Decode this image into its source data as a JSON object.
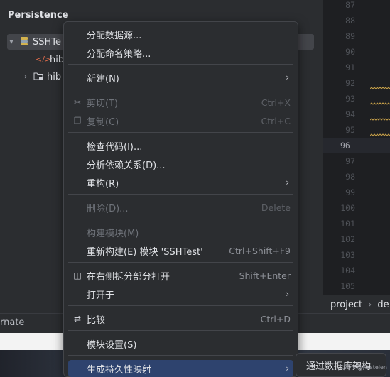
{
  "panel": {
    "title": "Persistence",
    "tree": [
      {
        "label": "SSHTe",
        "chevron": "▾",
        "icon": "module-icon"
      },
      {
        "label": "hib",
        "chevron": "",
        "icon": "xml-icon"
      },
      {
        "label": "hib",
        "chevron": "›",
        "icon": "folder-icon"
      }
    ]
  },
  "editor": {
    "lines": [
      "87",
      "88",
      "89",
      "90",
      "91",
      "92",
      "93",
      "94",
      "95",
      "96",
      "97",
      "98",
      "99",
      "100",
      "101",
      "102",
      "103",
      "104",
      "105"
    ],
    "current_line": "96"
  },
  "breadcrumb": {
    "item1": "project",
    "sep": "›",
    "item2": "de"
  },
  "bottom": {
    "text": "rnate"
  },
  "menu": {
    "items": [
      {
        "label": "分配数据源...",
        "shortcut": "",
        "icon": "",
        "disabled": false,
        "arrow": false
      },
      {
        "label": "分配命名策略...",
        "shortcut": "",
        "icon": "",
        "disabled": false,
        "arrow": false
      },
      {
        "label": "新建(N)",
        "shortcut": "",
        "icon": "",
        "disabled": false,
        "arrow": true
      },
      {
        "label": "剪切(T)",
        "shortcut": "Ctrl+X",
        "icon": "scissors-icon",
        "disabled": true,
        "arrow": false
      },
      {
        "label": "复制(C)",
        "shortcut": "Ctrl+C",
        "icon": "copy-icon",
        "disabled": true,
        "arrow": false
      },
      {
        "label": "检查代码(I)...",
        "shortcut": "",
        "icon": "",
        "disabled": false,
        "arrow": false
      },
      {
        "label": "分析依赖关系(D)...",
        "shortcut": "",
        "icon": "",
        "disabled": false,
        "arrow": false
      },
      {
        "label": "重构(R)",
        "shortcut": "",
        "icon": "",
        "disabled": false,
        "arrow": true
      },
      {
        "label": "删除(D)...",
        "shortcut": "Delete",
        "icon": "",
        "disabled": true,
        "arrow": false
      },
      {
        "label": "构建模块(M)",
        "shortcut": "",
        "icon": "",
        "disabled": true,
        "arrow": false
      },
      {
        "label": "重新构建(E) 模块 'SSHTest'",
        "shortcut": "Ctrl+Shift+F9",
        "icon": "",
        "disabled": false,
        "arrow": false
      },
      {
        "label": "在右侧拆分部分打开",
        "shortcut": "Shift+Enter",
        "icon": "split-icon",
        "disabled": false,
        "arrow": false
      },
      {
        "label": "打开于",
        "shortcut": "",
        "icon": "",
        "disabled": false,
        "arrow": true
      },
      {
        "label": "比较",
        "shortcut": "Ctrl+D",
        "icon": "compare-icon",
        "disabled": false,
        "arrow": false
      },
      {
        "label": "模块设置(S)",
        "shortcut": "",
        "icon": "",
        "disabled": false,
        "arrow": false
      },
      {
        "label": "生成持久性映射",
        "shortcut": "",
        "icon": "",
        "disabled": false,
        "arrow": true
      }
    ]
  },
  "submenu": {
    "label": "通过数据库架构"
  },
  "watermark": "CSDN @Kestelen"
}
